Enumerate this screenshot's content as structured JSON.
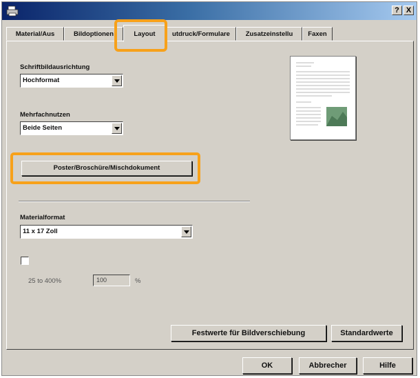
{
  "window": {
    "help_label": "?",
    "close_label": "X"
  },
  "tabs": [
    {
      "label": "Material/Aus"
    },
    {
      "label": "Bildoptionen"
    },
    {
      "label": "Layout"
    },
    {
      "label": "utdruck/Formulare"
    },
    {
      "label": "Zusatzeinstellu"
    },
    {
      "label": "Faxen"
    }
  ],
  "active_tab": "Layout",
  "layout": {
    "orientation_label": "Schriftbildausrichtung",
    "orientation_value": "Hochformat",
    "duplex_label": "Mehrfachnutzen",
    "duplex_value": "Beide Seiten",
    "poster_button": "Poster/Broschüre/Mischdokument",
    "paper_label": "Materialformat",
    "paper_value": "11 x 17 Zoll",
    "scale_range": "25 to 400%",
    "scale_value": "100",
    "scale_unit": "%",
    "shift_button": "Festwerte für Bildverschiebung",
    "defaults_button": "Standardwerte"
  },
  "footer": {
    "ok": "OK",
    "cancel": "Abbrecher",
    "help": "Hilfe"
  },
  "colors": {
    "highlight": "#f7a11a",
    "face": "#d4d0c8"
  }
}
